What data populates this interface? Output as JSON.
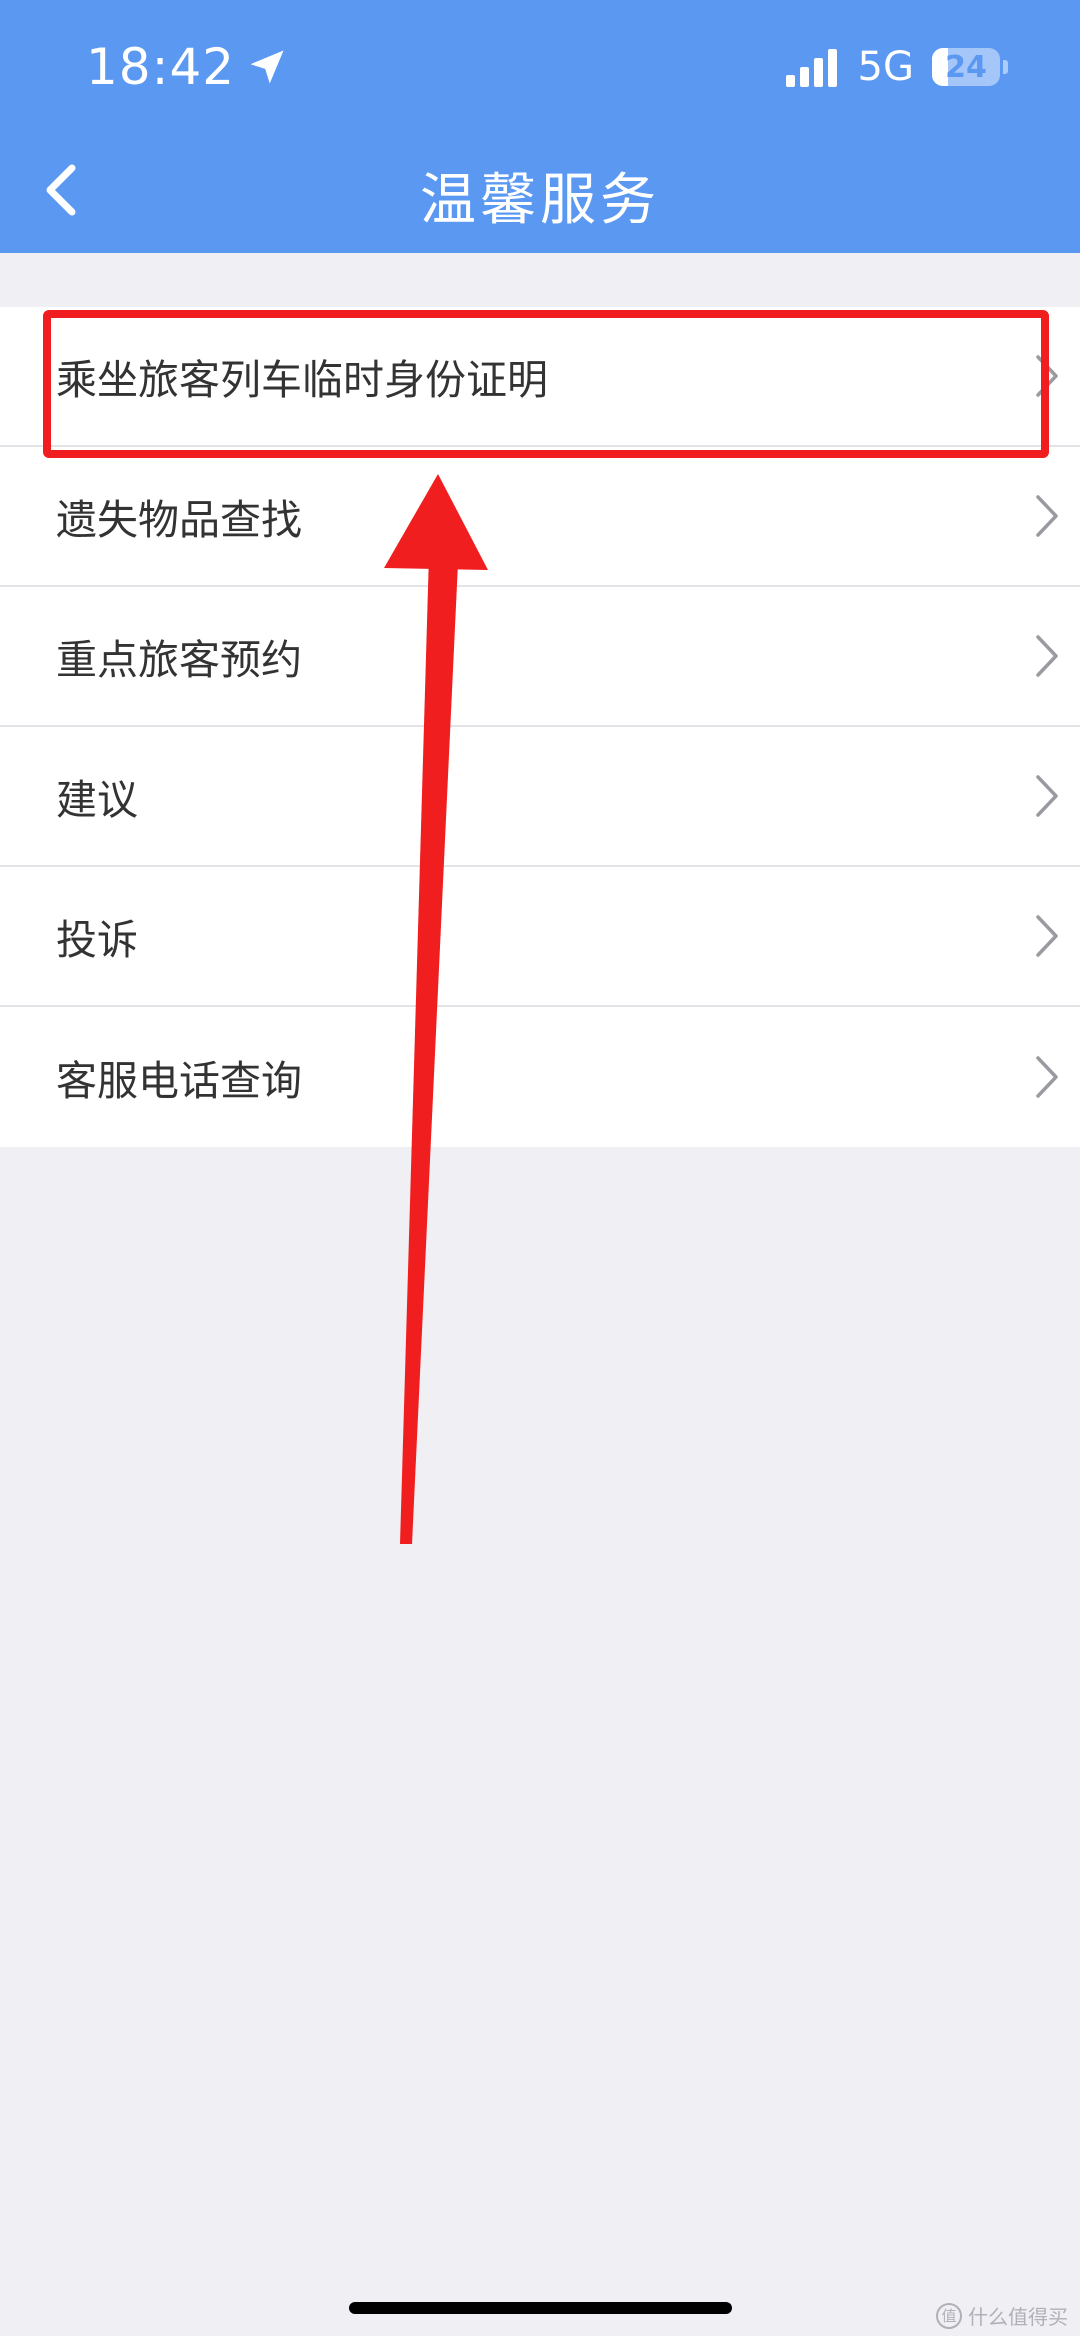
{
  "status_bar": {
    "time": "18:42",
    "network": "5G",
    "battery_level": "24",
    "battery_fraction": 0.24,
    "location_icon": "location-arrow-icon",
    "signal_icon": "signal-bars-icon"
  },
  "header": {
    "title": "温馨服务",
    "back_icon": "chevron-left-icon",
    "background": "#5a98f2"
  },
  "menu": {
    "items": [
      {
        "label": "乘坐旅客列车临时身份证明"
      },
      {
        "label": "遗失物品查找"
      },
      {
        "label": "重点旅客预约"
      },
      {
        "label": "建议"
      },
      {
        "label": "投诉"
      },
      {
        "label": "客服电话查询"
      }
    ],
    "chevron_icon": "chevron-right-icon"
  },
  "annotation": {
    "color": "#f01e1e",
    "highlighted_item": "乘坐旅客列车临时身份证明"
  },
  "watermark": {
    "logo_text": "值",
    "text": "什么值得买"
  }
}
